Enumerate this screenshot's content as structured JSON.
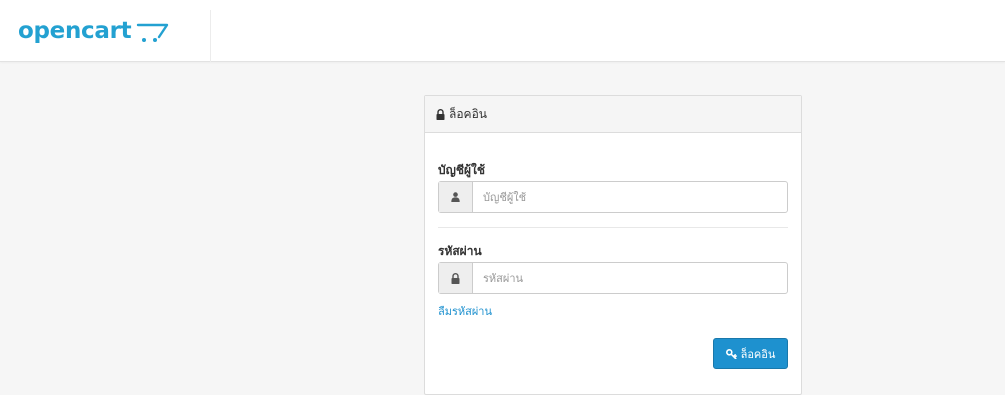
{
  "header": {
    "logo_text": "opencart"
  },
  "login_panel": {
    "title": "ล็อคอิน",
    "username": {
      "label": "บัญชีผู้ใช้",
      "placeholder": "บัญชีผู้ใช้",
      "value": ""
    },
    "password": {
      "label": "รหัสผ่าน",
      "placeholder": "รหัสผ่าน",
      "value": ""
    },
    "forgot_link": "ลืมรหัสผ่าน",
    "submit_label": "ล็อคอิน"
  },
  "colors": {
    "brand": "#23a1d1",
    "button": "#1e91cf",
    "link": "#1e91cf",
    "page_bg": "#f6f6f6"
  },
  "icons": {
    "heading": "lock-icon",
    "username_addon": "user-icon",
    "password_addon": "lock-icon",
    "submit": "key-icon",
    "logo": "cart-icon"
  }
}
